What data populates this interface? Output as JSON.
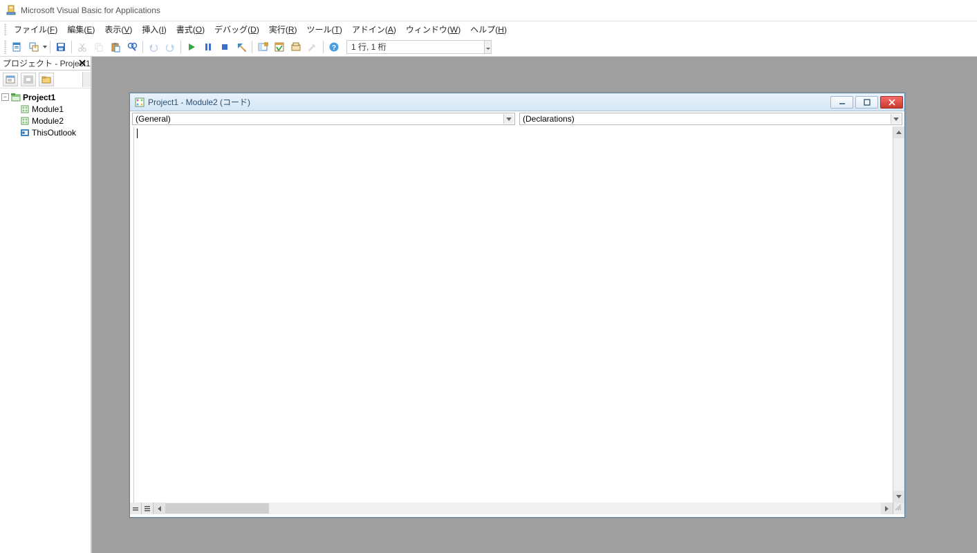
{
  "app": {
    "title": "Microsoft Visual Basic for Applications"
  },
  "menu": {
    "file": {
      "label": "ファイル",
      "mn": "F"
    },
    "edit": {
      "label": "編集",
      "mn": "E"
    },
    "view": {
      "label": "表示",
      "mn": "V"
    },
    "insert": {
      "label": "挿入",
      "mn": "I"
    },
    "format": {
      "label": "書式",
      "mn": "O"
    },
    "debug": {
      "label": "デバッグ",
      "mn": "D"
    },
    "run": {
      "label": "実行",
      "mn": "R"
    },
    "tools": {
      "label": "ツール",
      "mn": "T"
    },
    "addins": {
      "label": "アドイン",
      "mn": "A"
    },
    "window": {
      "label": "ウィンドウ",
      "mn": "W"
    },
    "help": {
      "label": "ヘルプ",
      "mn": "H"
    }
  },
  "toolbar": {
    "position": "1 行, 1 桁"
  },
  "project_pane": {
    "title": "プロジェクト - Project1",
    "root": "Project1",
    "children": [
      "Module1",
      "Module2",
      "ThisOutlook"
    ]
  },
  "codewin": {
    "title": "Project1 - Module2 (コード)",
    "object_select": "(General)",
    "proc_select": "(Declarations)"
  }
}
